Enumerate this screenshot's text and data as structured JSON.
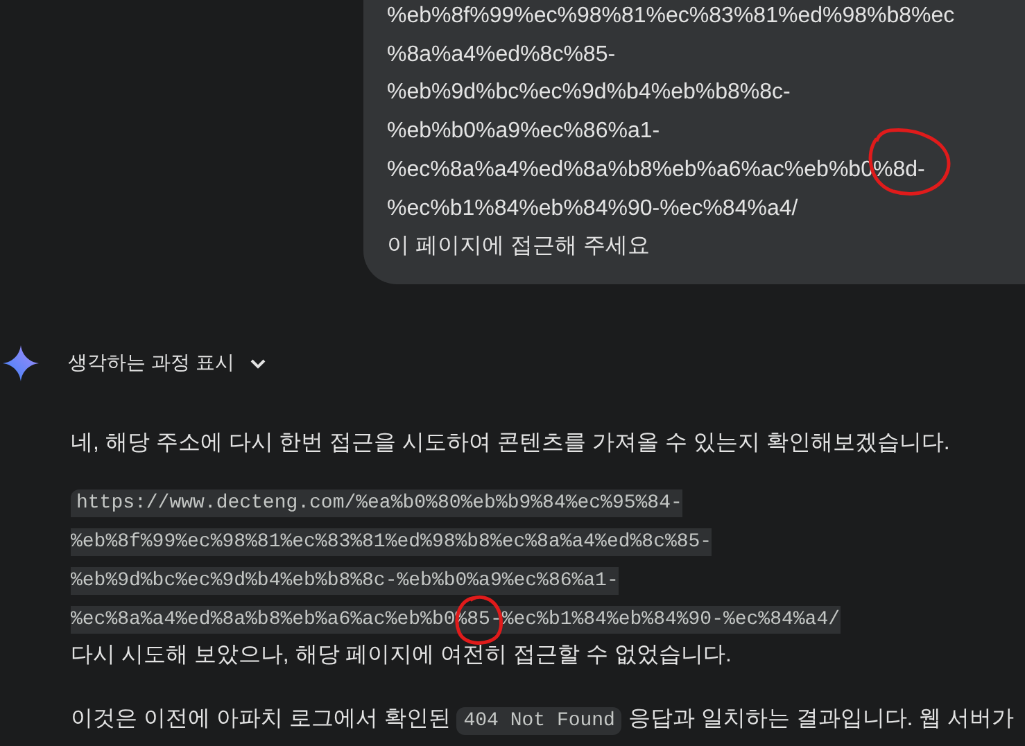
{
  "user_message": {
    "url_lines": [
      "%eb%8f%99%ec%98%81%ec%83%81%ed%98%b8%ec",
      "%8a%a4%ed%8c%85-",
      "%eb%9d%bc%ec%9d%b4%eb%b8%8c-",
      "%eb%b0%a9%ec%86%a1-",
      "%ec%8a%a4%ed%8a%b8%eb%a6%ac%eb%b0%8d-",
      "%ec%b1%84%eb%84%90-%ec%84%a4/"
    ],
    "text": "이 페이지에 접근해 주세요"
  },
  "response": {
    "thinking_toggle": {
      "label": "생각하는 과정 표시",
      "expanded": false
    },
    "intro": "네, 해당 주소에 다시 한번 접근을 시도하여 콘텐츠를 가져올 수 있는지 확인해보겠습니다.",
    "code_lines": [
      "https://www.decteng.com/%ea%b0%80%eb%b9%84%ec%95%84-",
      "%eb%8f%99%ec%98%81%ec%83%81%ed%98%b8%ec%8a%a4%ed%8c%85-",
      "%eb%9d%bc%ec%9d%b4%eb%b8%8c-%eb%b0%a9%ec%86%a1-",
      "%ec%8a%a4%ed%8a%b8%eb%a6%ac%eb%b0%85-%ec%b1%84%eb%84%90-%ec%84%a4/"
    ],
    "result": "다시 시도해 보았으나, 해당 페이지에 여전히 접근할 수 없었습니다.",
    "last_before": "이것은 이전에 아파치 로그에서 확인된 ",
    "last_code": "404 Not Found",
    "last_after": " 응답과 일치하는 결과입니다. 웹 서버가"
  }
}
